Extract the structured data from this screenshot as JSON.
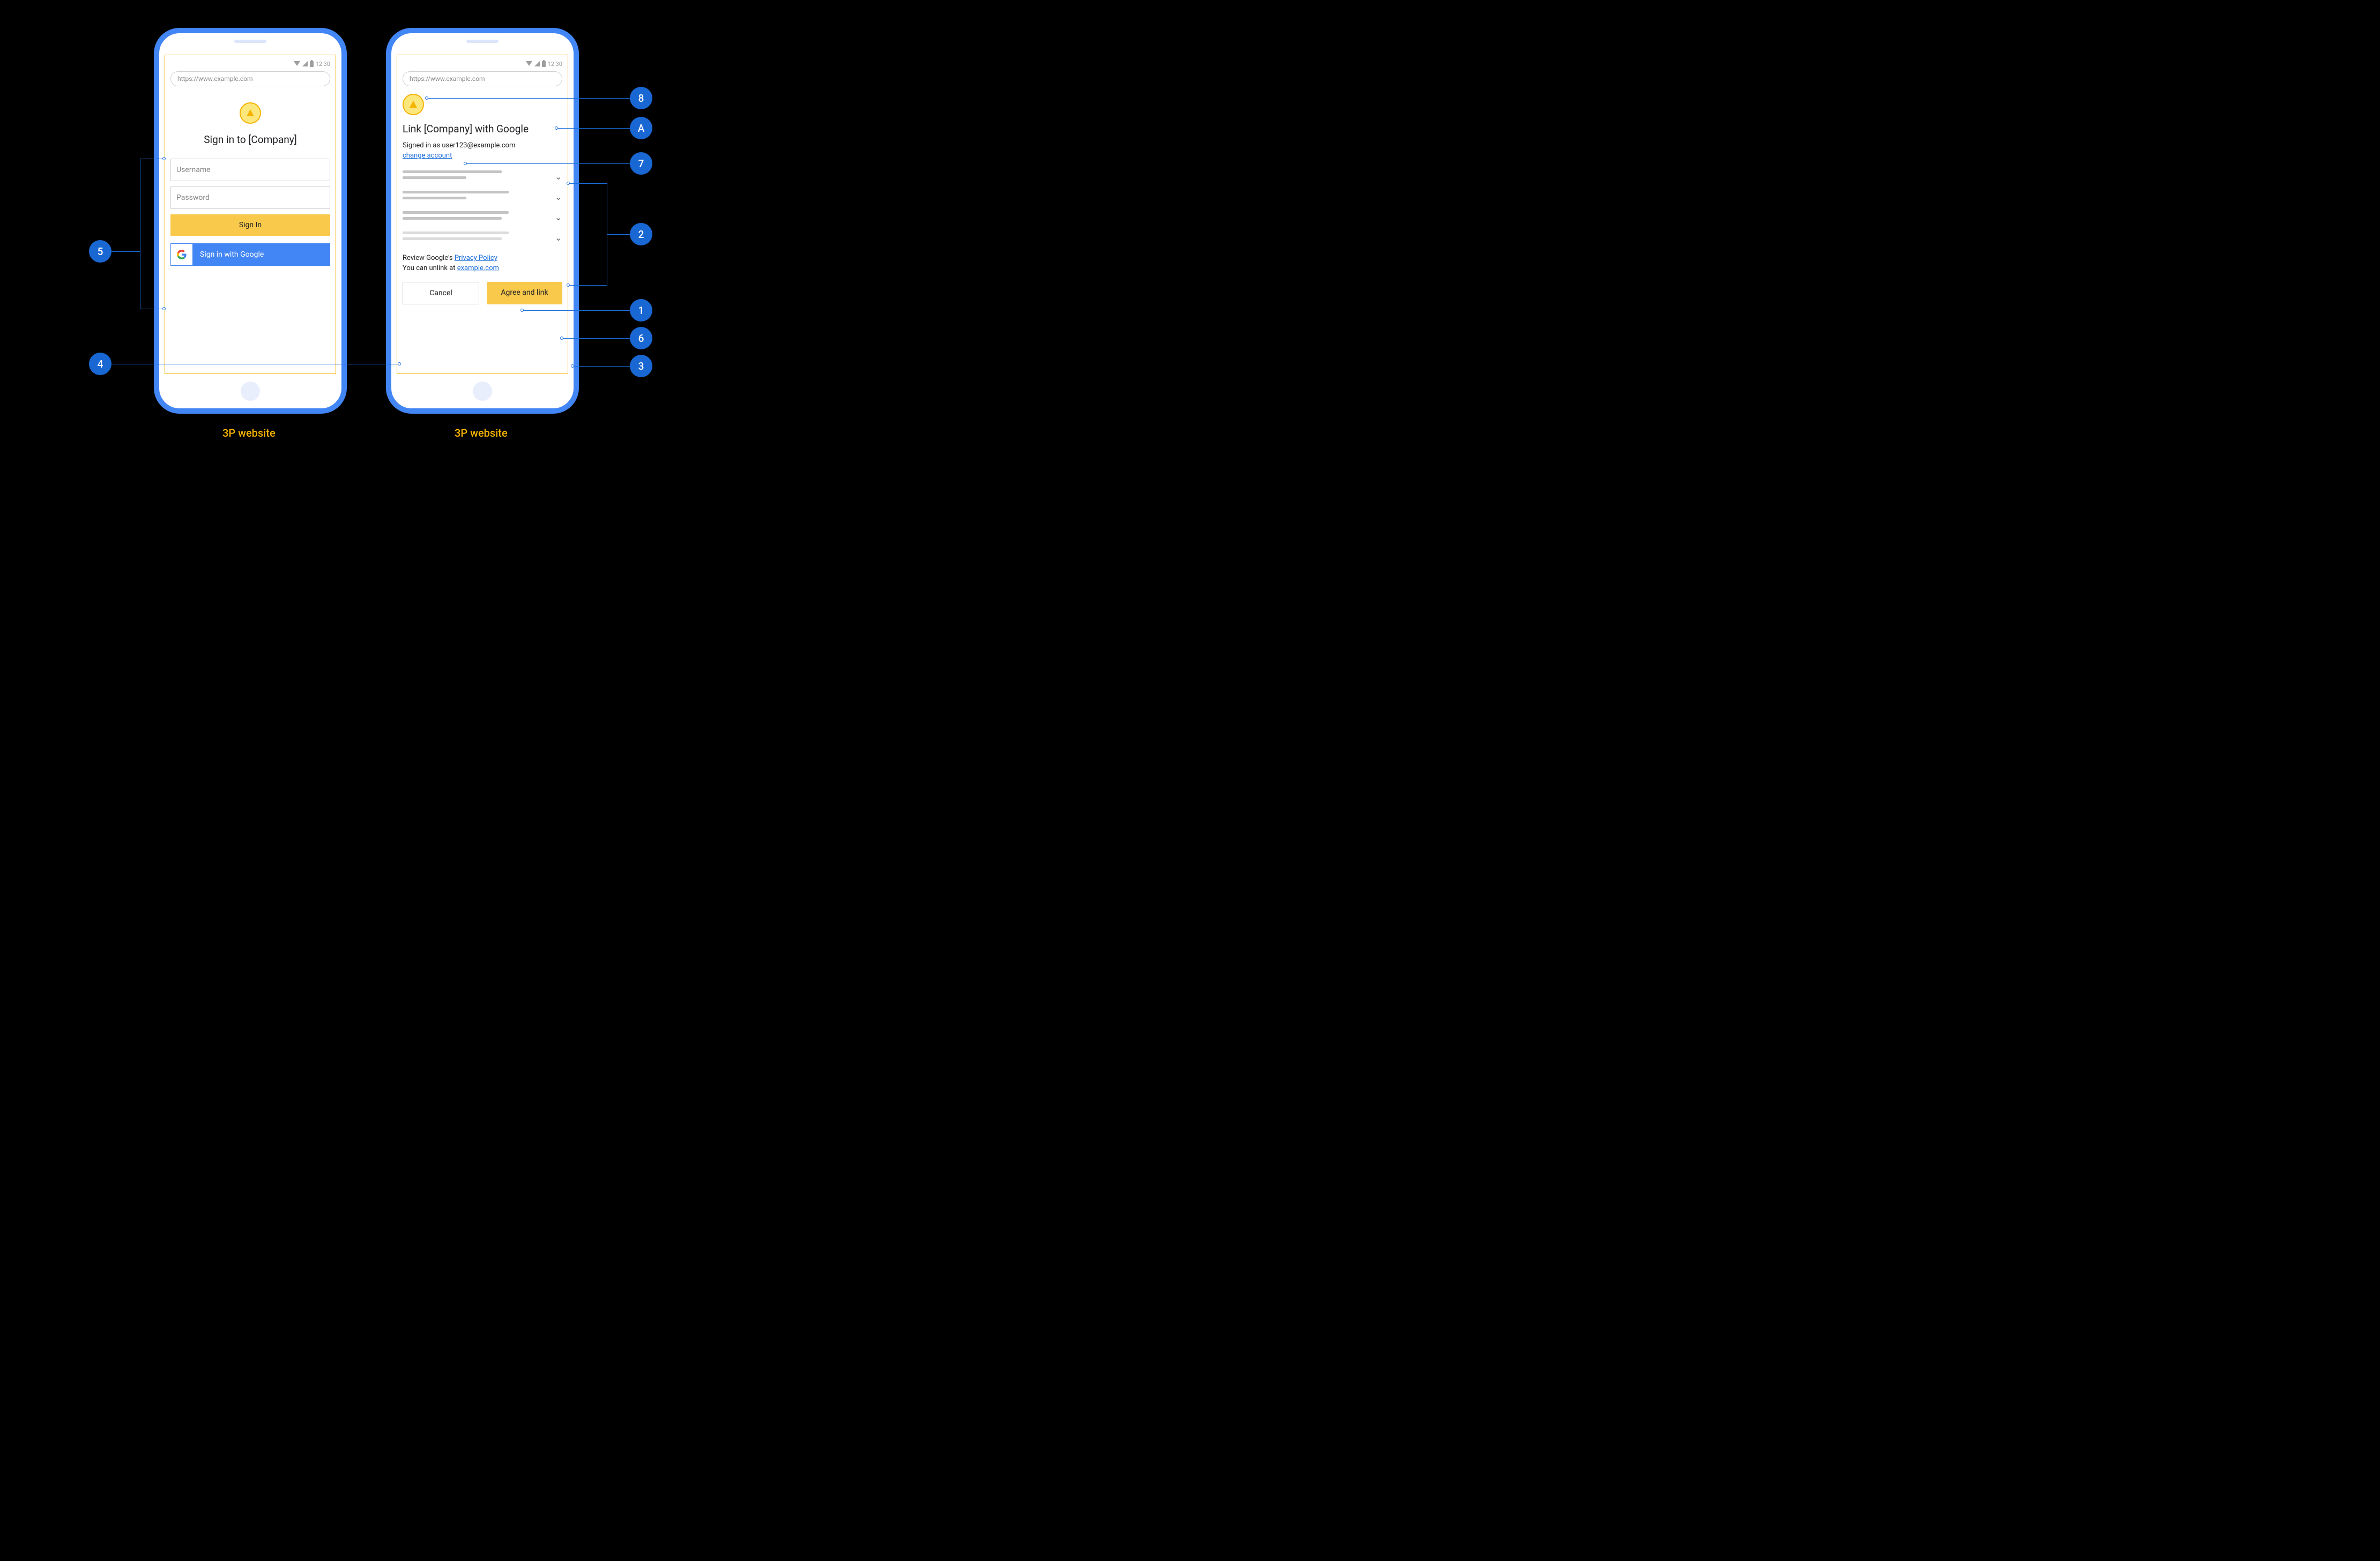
{
  "status": {
    "time": "12:30"
  },
  "url": "https://www.example.com",
  "signin": {
    "heading": "Sign in to [Company]",
    "username_ph": "Username",
    "password_ph": "Password",
    "signin_btn": "Sign In",
    "google_btn": "Sign in with Google"
  },
  "consent": {
    "heading": "Link [Company] with Google",
    "signed_in_prefix": "Signed in as ",
    "signed_in_user": "user123@example.com",
    "change_account": "change account",
    "review_prefix": "Review Google's ",
    "privacy_link": "Privacy Policy",
    "unlink_prefix": "You can unlink at ",
    "unlink_link": "example.com",
    "cancel": "Cancel",
    "agree": "Agree and link"
  },
  "captions": {
    "left": "3P website",
    "right": "3P website"
  },
  "callouts": {
    "c1": "1",
    "c2": "2",
    "c3": "3",
    "c4": "4",
    "c5": "5",
    "c6": "6",
    "c7": "7",
    "c8": "8",
    "cA": "A"
  }
}
